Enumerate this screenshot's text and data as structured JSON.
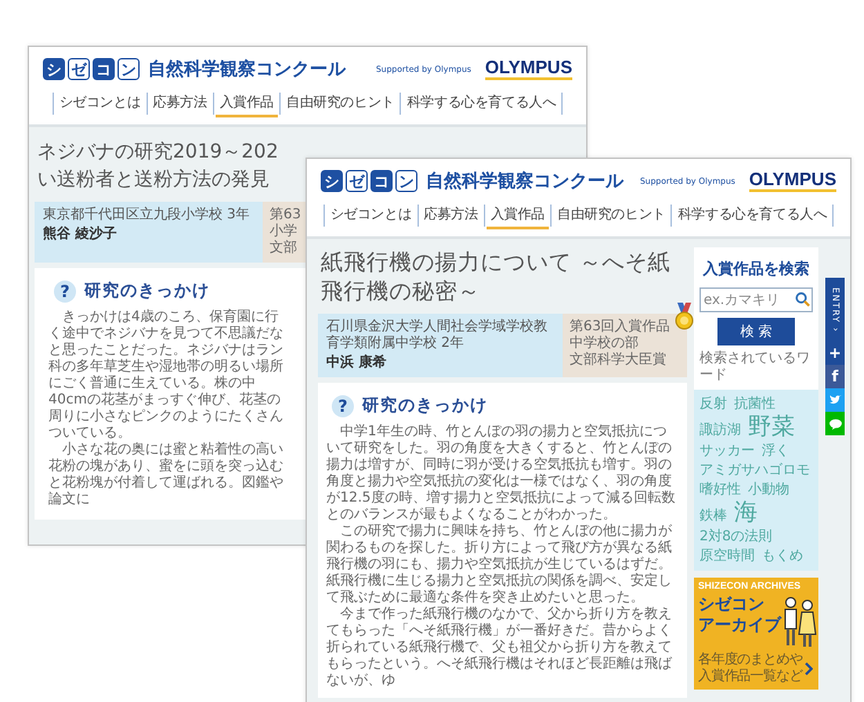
{
  "back_page": {
    "header": {
      "logo": [
        {
          "char": "シ",
          "filled": true
        },
        {
          "char": "ゼ",
          "filled": false
        },
        {
          "char": "コ",
          "filled": true
        },
        {
          "char": "ン",
          "filled": false
        }
      ],
      "site_name": "自然科学観察コンクール",
      "supported": "Supported by Olympus",
      "sponsor": "OLYMPUS"
    },
    "nav": [
      {
        "label": "シゼコンとは",
        "selected": false
      },
      {
        "label": "応募方法",
        "selected": false
      },
      {
        "label": "入賞作品",
        "selected": true
      },
      {
        "label": "自由研究のヒント",
        "selected": false
      },
      {
        "label": "科学する心を育てる人へ",
        "selected": false
      }
    ],
    "title_lines": [
      "ネジバナの研究2019～202",
      "い送粉者と送粉方法の発見"
    ],
    "info": {
      "school": "東京都千代田区立九段小学校 3年",
      "name": "熊谷 綾沙子",
      "award_lines": [
        "第63",
        "小学",
        "文部"
      ]
    },
    "section": {
      "icon": "?",
      "heading": "研究のきっかけ",
      "paragraphs": [
        "きっかけは4歳のころ、保育園に行く途中でネジバナを見つて不思議だなと思ったことだった。ネジバナはラン科の多年草芝生や湿地帯の明るい場所にごく普通に生えている。株の中40cmの花茎がまっすぐ伸び、花茎の周りに小さなピンクのようにたくさんついている。",
        "小さな花の奥には蜜と粘着性の高い花粉の塊があり、蜜をに頭を突っ込むと花粉塊が付着して運ばれる。図鑑や論文に"
      ]
    }
  },
  "front_page": {
    "header": {
      "logo": [
        {
          "char": "シ",
          "filled": true
        },
        {
          "char": "ゼ",
          "filled": false
        },
        {
          "char": "コ",
          "filled": true
        },
        {
          "char": "ン",
          "filled": false
        }
      ],
      "site_name": "自然科学観察コンクール",
      "supported": "Supported by Olympus",
      "sponsor": "OLYMPUS"
    },
    "nav": [
      {
        "label": "シゼコンとは",
        "selected": false
      },
      {
        "label": "応募方法",
        "selected": false
      },
      {
        "label": "入賞作品",
        "selected": true
      },
      {
        "label": "自由研究のヒント",
        "selected": false
      },
      {
        "label": "科学する心を育てる人へ",
        "selected": false
      }
    ],
    "title_lines": [
      "紙飛行機の揚力について ～へそ紙飛行機の秘密～"
    ],
    "info": {
      "school": "石川県金沢大学人間社会学域学校教育学類附属中学校 2年",
      "name": "中浜 康希",
      "award_lines": [
        "第63回入賞作品",
        "中学校の部",
        "文部科学大臣賞"
      ]
    },
    "section": {
      "icon": "?",
      "heading": "研究のきっかけ",
      "paragraphs": [
        "中学1年生の時、竹とんぼの羽の揚力と空気抵抗について研究をした。羽の角度を大きくすると、竹とんぼの揚力は増すが、同時に羽が受ける空気抵抗も増す。羽の角度と揚力や空気抵抗の変化は一様ではなく、羽の角度が12.5度の時、増す揚力と空気抵抗によって減る回転数とのバランスが最もよくなることがわかった。",
        "この研究で揚力に興味を持ち、竹とんぼの他に揚力が関わるものを探した。折り方によって飛び方が異なる紙飛行機の羽にも、揚力や空気抵抗が生じているはずだ。紙飛行機に生じる揚力と空気抵抗の関係を調べ、安定して飛ぶために最適な条件を突き止めたいと思った。",
        "今まで作った紙飛行機のなかで、父から折り方を教えてもらった「へそ紙飛行機」が一番好きだ。昔からよく折られている紙飛行機で、父も祖父から折り方を教えてもらったという。へそ紙飛行機はそれほど長距離は飛ばないが、ゆ"
      ]
    },
    "sidebar": {
      "heading": "入賞作品を検索",
      "search": {
        "placeholder": "ex.カマキリ"
      },
      "button": "検 索",
      "popular_label": "検索されているワード",
      "tags": [
        {
          "label": "反射",
          "kind": "small"
        },
        {
          "label": "抗菌性",
          "kind": "small"
        },
        {
          "label": "諏訪湖",
          "kind": "small"
        },
        {
          "label": "野菜",
          "kind": "large"
        },
        {
          "label": "サッカー",
          "kind": "small"
        },
        {
          "label": "浮く",
          "kind": "small"
        },
        {
          "label": "アミガサハゴロモ",
          "kind": "small"
        },
        {
          "label": "嗜好性",
          "kind": "small"
        },
        {
          "label": "小動物",
          "kind": "small"
        },
        {
          "label": "鉄棒",
          "kind": "small"
        },
        {
          "label": "海",
          "kind": "large"
        },
        {
          "label": "2対8の法則",
          "kind": "small"
        },
        {
          "label": "原空時間",
          "kind": "small"
        },
        {
          "label": "もくめ",
          "kind": "small"
        }
      ],
      "archives": {
        "title": "SHIZECON ARCHIVES",
        "name_lines": [
          "シゼコン",
          "アーカイブ"
        ],
        "caption_lines": [
          "各年度のまとめや",
          "入賞作品一覧など"
        ]
      }
    },
    "side_buttons": [
      {
        "kind": "entry",
        "label": "ENTRY ›"
      },
      {
        "kind": "plus",
        "label": "+"
      },
      {
        "kind": "facebook",
        "label": "f"
      },
      {
        "kind": "twitter"
      },
      {
        "kind": "line"
      }
    ]
  }
}
